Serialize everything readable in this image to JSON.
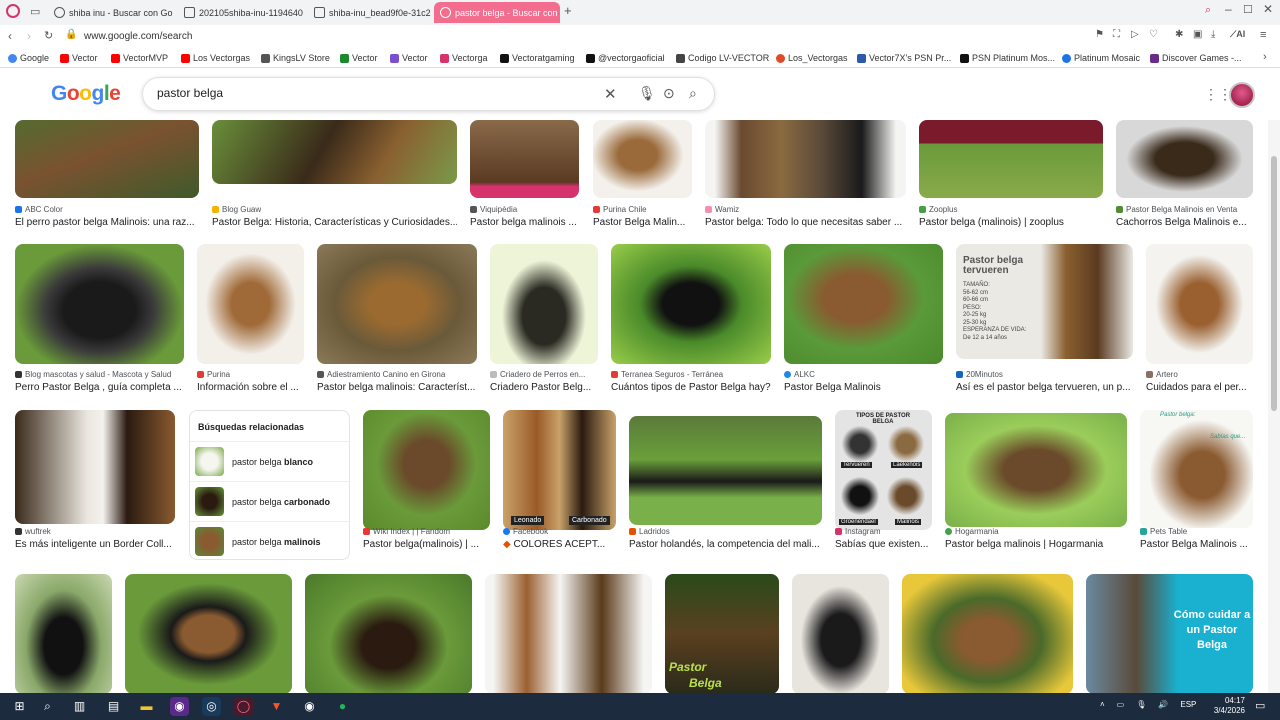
{
  "browser": {
    "tabs": [
      {
        "label": "shiba inu - Buscar con Go"
      },
      {
        "label": "202105shiba-inu-1194640"
      },
      {
        "label": "shiba-inu_bead9f0e-31c2"
      },
      {
        "label": "pastor belga - Buscar con",
        "active": true
      }
    ],
    "new_tab": "+",
    "url": "www.google.com/search",
    "bookmarks": [
      {
        "label": "Google",
        "color": "#4285f4"
      },
      {
        "label": "Vector",
        "color": "#ff0000"
      },
      {
        "label": "VectorMVP",
        "color": "#ff0000"
      },
      {
        "label": "Los Vectorgas",
        "color": "#ff0000"
      },
      {
        "label": "KingsLV Store",
        "color": "#555555"
      },
      {
        "label": "Vector",
        "color": "#1a8a2a"
      },
      {
        "label": "Vector",
        "color": "#7b4fcf"
      },
      {
        "label": "Vectorga",
        "color": "#d6336c"
      },
      {
        "label": "Vectoratgaming",
        "color": "#111111"
      },
      {
        "label": "@vectorgaoficial",
        "color": "#111111"
      },
      {
        "label": "Codigo LV-VECTOR",
        "color": "#444444"
      },
      {
        "label": "Los_Vectorgas",
        "color": "#e04a2a"
      },
      {
        "label": "Vector7X's PSN Pr...",
        "color": "#2a5aa8"
      },
      {
        "label": "PSN Platinum Mos...",
        "color": "#111111"
      },
      {
        "label": "Platinum Mosaic",
        "color": "#1a73e8"
      },
      {
        "label": "Discover Games -...",
        "color": "#6a2a8a"
      }
    ]
  },
  "google": {
    "logo": "Google",
    "query": "pastor belga"
  },
  "row1": [
    {
      "source": "ABC Color",
      "title": "El perro pastor belga Malinois: una raz...",
      "icon_color": "#1a73e8"
    },
    {
      "source": "Blog Guaw",
      "title": "Pastor Belga: Historia, Características y Curiosidades...",
      "icon_color": "#f4b400"
    },
    {
      "source": "Viquipèdia",
      "title": "Pastor belga malinois ...",
      "icon_color": "#555555"
    },
    {
      "source": "Purina Chile",
      "title": "Pastor Belga Malin...",
      "icon_color": "#e53935"
    },
    {
      "source": "Wamiz",
      "title": "Pastor belga: Todo lo que necesitas saber ...",
      "icon_color": "#f48fb1"
    },
    {
      "source": "Zooplus",
      "title": "Pastor belga (malinois) | zooplus",
      "icon_color": "#43a047"
    },
    {
      "source": "Pastor Belga Malinois en Venta",
      "title": "Cachorros Belga Malinois e...",
      "icon_color": "#558b2f"
    }
  ],
  "row2": [
    {
      "source": "Blog mascotas y salud - Mascota y Salud",
      "title": "Perro Pastor Belga , guía completa ...",
      "icon_color": "#333333"
    },
    {
      "source": "Purina",
      "title": "Información sobre el ...",
      "icon_color": "#e53935"
    },
    {
      "source": "Adiestramiento Canino en Girona",
      "title": "Pastor belga malinois: Característ...",
      "icon_color": "#555555"
    },
    {
      "source": "Criadero de Perros en...",
      "title": "Criadero Pastor Belg...",
      "icon_color": "#bbbbbb"
    },
    {
      "source": "Terranea Seguros - Terránea",
      "title": "Cuántos tipos de Pastor Belga hay?",
      "icon_color": "#e53935"
    },
    {
      "source": "ALKC",
      "title": "Pastor Belga Malinois",
      "icon_color": "#1e88e5"
    },
    {
      "source": "20Minutos",
      "title": "Así es el pastor belga tervueren, un p...",
      "icon_color": "#1565c0"
    },
    {
      "source": "Artero",
      "title": "Cuidados para el per...",
      "icon_color": "#8d6e63"
    }
  ],
  "infographic": {
    "title": "Pastor belga tervueren",
    "lines": [
      "TAMAÑO:",
      "56-62 cm",
      "60-66 cm",
      "PESO:",
      "20-25 kg",
      "25-30 kg",
      "ESPERANZA DE VIDA:",
      "De 12 a 14 años"
    ]
  },
  "related": {
    "heading": "Búsquedas relacionadas",
    "items": [
      {
        "prefix": "pastor belga ",
        "bold": "blanco"
      },
      {
        "prefix": "pastor belga ",
        "bold": "carbonado"
      },
      {
        "prefix": "pastor belga ",
        "bold": "malinois"
      }
    ]
  },
  "row3": [
    {
      "source": "wuftrek",
      "title": "Es más inteligente un Border Coll...",
      "icon_color": "#333333"
    },
    {
      "source": "Wiki Index | | Fandom",
      "title": "Pastor belga(malinois) | ...",
      "icon_color": "#e53935"
    },
    {
      "source": "Facebook",
      "title": "COLORES ACEPT...",
      "icon_color": "#1877f2"
    },
    {
      "source": "Ladridos",
      "title": "Pastor holandés, la competencia del mali...",
      "icon_color": "#e65100"
    },
    {
      "source": "Instagram",
      "title": "Sabías que existen...",
      "icon_color": "#d6336c"
    },
    {
      "source": "Hogarmania",
      "title": "Pastor belga malinois | Hogarmania",
      "icon_color": "#43a047"
    },
    {
      "source": "Pets Table",
      "title": "Pastor Belga Malinois ...",
      "icon_color": "#26a69a"
    }
  ],
  "image_labels": {
    "leonado": "Leonado",
    "carbonado": "Carbonado",
    "tipos_title": "TIPOS DE PASTOR BELGA",
    "tervueren": "Tervueren",
    "laekenois": "Laekenois",
    "groenendael": "Groenendael",
    "malinois": "Malinois",
    "pastor_belga_q1": "Pastor belga:",
    "sabias": "Sabías que...",
    "pastor_label": "Pastor",
    "belga_label": "Belga",
    "como_cuidar": "Cómo cuidar a un Pastor Belga"
  },
  "taskbar": {
    "lang": "ESP",
    "time": "04:17",
    "date": "3/4/2026"
  }
}
